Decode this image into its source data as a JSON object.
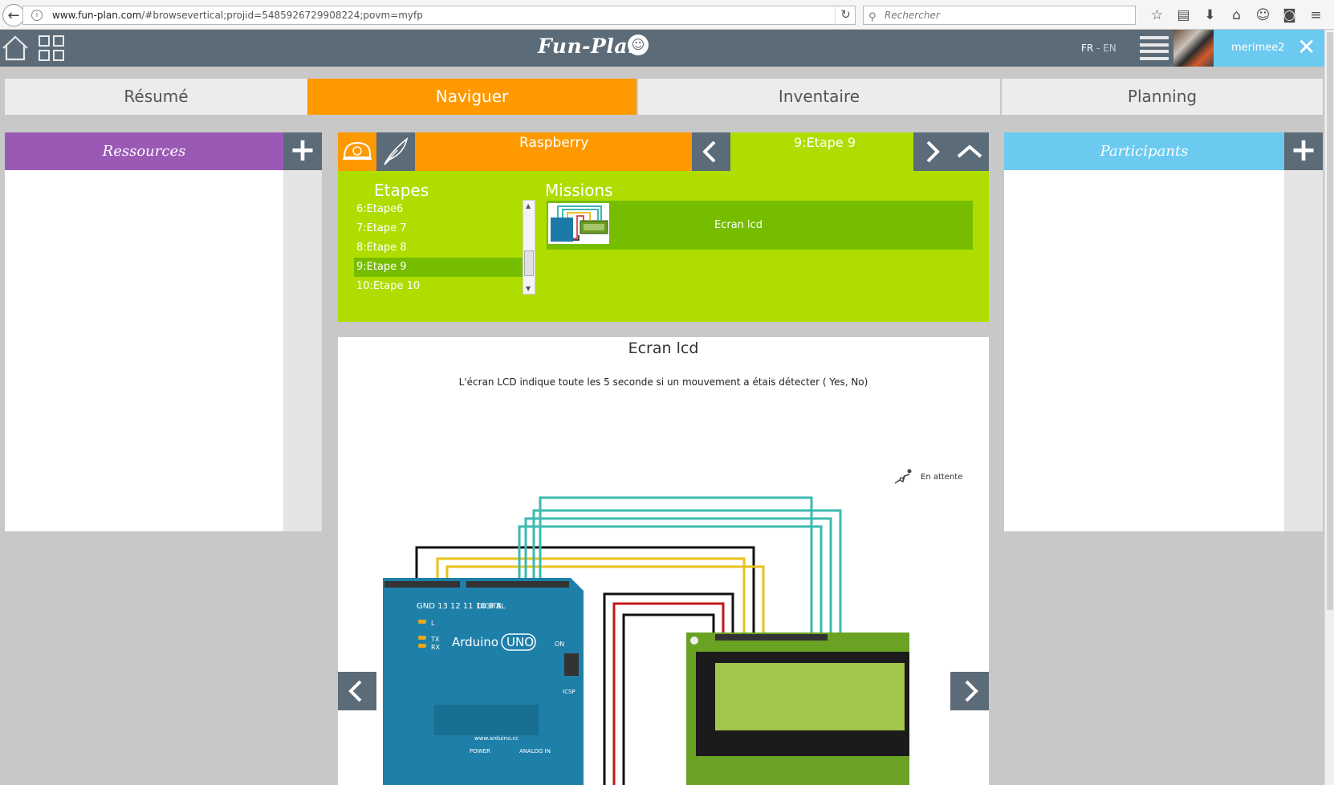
{
  "browser": {
    "url_host": "www.fun-plan.com",
    "url_rest": "/#browsevertical;projid=5485926729908224;povm=myfp",
    "search_placeholder": "Rechercher"
  },
  "header": {
    "logo": "Fun-Plan",
    "lang_active": "FR",
    "lang_sep": " - ",
    "lang_other": "EN",
    "username": "merimee2",
    "close_glyph": "✕"
  },
  "tabs": [
    {
      "label": "Résumé",
      "active": false
    },
    {
      "label": "Naviguer",
      "active": true
    },
    {
      "label": "Inventaire",
      "active": false
    },
    {
      "label": "Planning",
      "active": false
    }
  ],
  "left_panel": {
    "title": "Ressources",
    "add": "+"
  },
  "right_panel": {
    "title": "Participants",
    "add": "+"
  },
  "nav": {
    "project": "Raspberry",
    "step": "9:Etape 9",
    "prev": "‹",
    "next": "›"
  },
  "etapes": {
    "title": "Etapes",
    "items": [
      {
        "label": "6:Etape6",
        "selected": false
      },
      {
        "label": "7:Etape 7",
        "selected": false
      },
      {
        "label": "8:Etape 8",
        "selected": false
      },
      {
        "label": "9:Etape 9",
        "selected": true
      },
      {
        "label": "10:Etape 10",
        "selected": false
      }
    ]
  },
  "missions": {
    "title": "Missions",
    "items": [
      {
        "label": "Ecran lcd"
      }
    ]
  },
  "detail": {
    "title": "Ecran lcd",
    "description": "L'écran LCD indique toute les 5 seconde si un mouvement a étais détecter ( Yes, No)",
    "status": "En attente",
    "board_label": "Arduino",
    "board_model": "UNO",
    "board_url": "www.arduino.cc",
    "digital_label": "DIGITAL",
    "analog_label": "ANALOG IN",
    "power_label": "POWER",
    "icsp_label": "ICSP",
    "on_label": "ON",
    "tx_label": "TX",
    "rx_label": "RX",
    "l_label": "L"
  },
  "colors": {
    "header": "#5c6b78",
    "orange": "#ff9900",
    "green": "#b0dd00",
    "green_dark": "#76bd00",
    "purple": "#9b59b6",
    "sky": "#6ccaf0"
  }
}
